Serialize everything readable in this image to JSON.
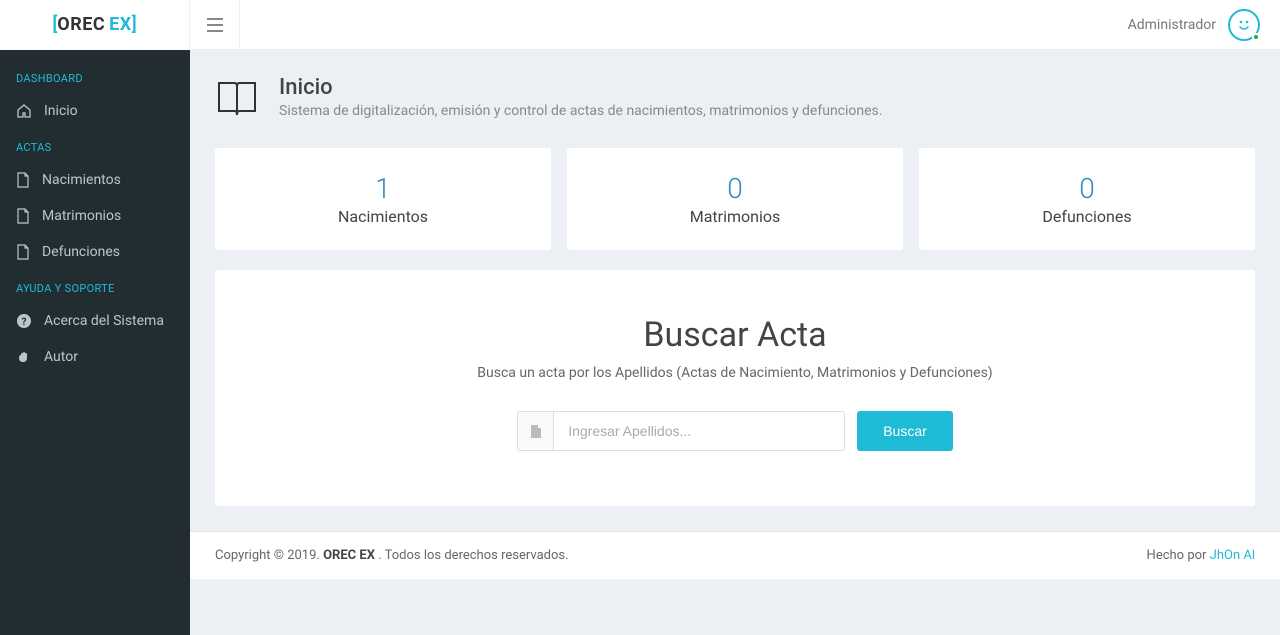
{
  "brand": {
    "part1": "OREC",
    "part2": "EX"
  },
  "header": {
    "user_label": "Administrador"
  },
  "sidebar": {
    "sections": {
      "dashboard_title": "DASHBOARD",
      "actas_title": "ACTAS",
      "ayuda_title": "AYUDA Y SOPORTE"
    },
    "items": {
      "inicio": "Inicio",
      "nacimientos": "Nacimientos",
      "matrimonios": "Matrimonios",
      "defunciones": "Defunciones",
      "acerca": "Acerca del Sistema",
      "autor": "Autor"
    }
  },
  "page": {
    "title": "Inicio",
    "subtitle": "Sistema de digitalización, emisión y control de actas de nacimientos, matrimonios y defunciones."
  },
  "stats": {
    "nacimientos": {
      "count": "1",
      "label": "Nacimientos"
    },
    "matrimonios": {
      "count": "0",
      "label": "Matrimonios"
    },
    "defunciones": {
      "count": "0",
      "label": "Defunciones"
    }
  },
  "search": {
    "title": "Buscar Acta",
    "subtitle": "Busca un acta por los Apellidos (Actas de Nacimiento, Matrimonios y Defunciones)",
    "placeholder": "Ingresar Apellidos...",
    "button": "Buscar"
  },
  "footer": {
    "prefix": "Copyright © 2019. ",
    "brand": "OREC EX",
    "suffix": ". Todos los derechos reservados.",
    "made_prefix": "Hecho por ",
    "made_by": "JhOn Al"
  }
}
